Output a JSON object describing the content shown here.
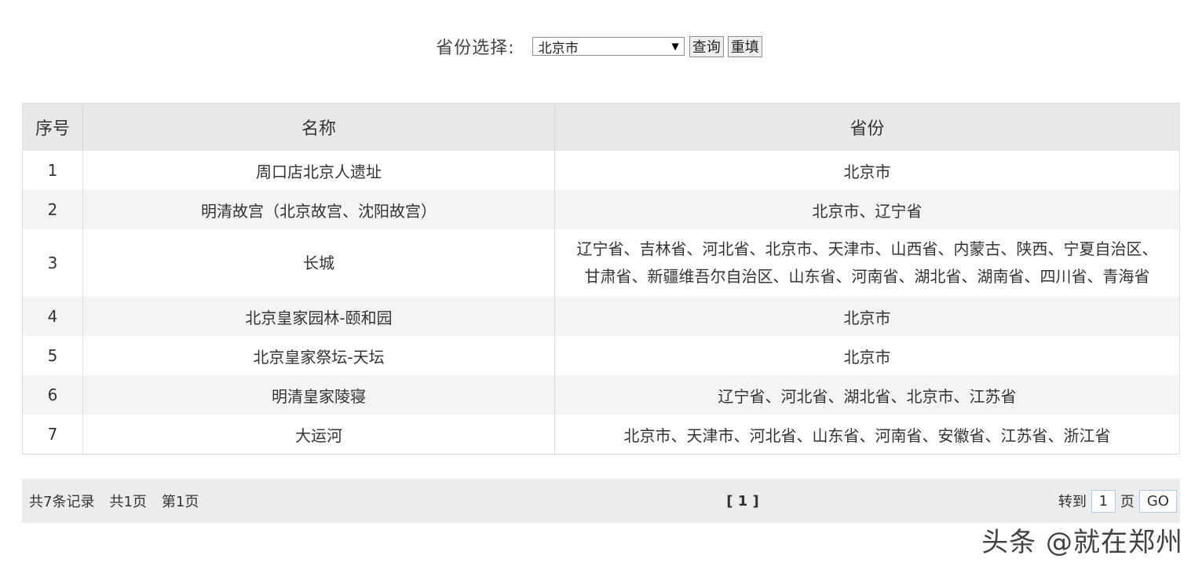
{
  "filter": {
    "label": "省份选择:",
    "selected_province": "北京市",
    "query_button": "查询",
    "reset_button": "重填"
  },
  "table": {
    "headers": [
      "序号",
      "名称",
      "省份"
    ],
    "rows": [
      {
        "idx": "1",
        "name": "周口店北京人遗址",
        "provinces": "北京市"
      },
      {
        "idx": "2",
        "name": "明清故宫（北京故宫、沈阳故宫）",
        "provinces": "北京市、辽宁省"
      },
      {
        "idx": "3",
        "name": "长城",
        "provinces_line1": "辽宁省、吉林省、河北省、北京市、天津市、山西省、内蒙古、陕西、宁夏自治区、",
        "provinces_line2": "甘肃省、新疆维吾尔自治区、山东省、河南省、湖北省、湖南省、四川省、青海省"
      },
      {
        "idx": "4",
        "name": "北京皇家园林-颐和园",
        "provinces": "北京市"
      },
      {
        "idx": "5",
        "name": "北京皇家祭坛-天坛",
        "provinces": "北京市"
      },
      {
        "idx": "6",
        "name": "明清皇家陵寝",
        "provinces": "辽宁省、河北省、湖北省、北京市、江苏省"
      },
      {
        "idx": "7",
        "name": "大运河",
        "provinces": "北京市、天津市、河北省、山东省、河南省、安徽省、江苏省、浙江省"
      }
    ]
  },
  "pager": {
    "total_records": "共7条记录",
    "total_pages": "共1页",
    "current_page": "第1页",
    "page_links": "[ 1 ]",
    "goto_label": "转到",
    "goto_value": "1",
    "page_unit": "页",
    "go_button": "GO"
  },
  "watermark": "头条 @就在郑州"
}
